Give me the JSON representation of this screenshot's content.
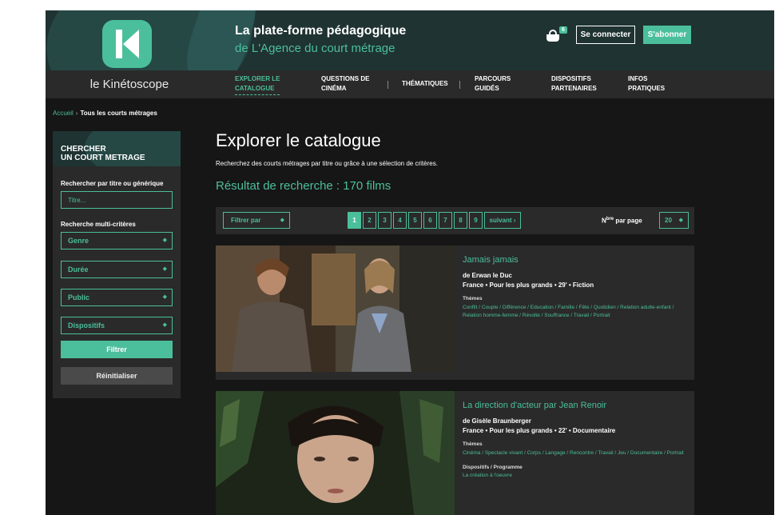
{
  "header": {
    "title_line1": "La plate-forme pédagogique",
    "title_line2": "de L'Agence du court métrage",
    "cart_count": "6",
    "login_label": "Se connecter",
    "subscribe_label": "S'abonner"
  },
  "nav": {
    "brand": "le Kinétoscope",
    "items": [
      {
        "line1": "EXPLORER LE",
        "line2": "CATALOGUE"
      },
      {
        "line1": "QUESTIONS DE",
        "line2": "CINÉMA"
      },
      {
        "line1": "THÉMATIQUES",
        "line2": ""
      },
      {
        "line1": "PARCOURS",
        "line2": "GUIDÉS"
      },
      {
        "line1": "DISPOSITIFS",
        "line2": "PARTENAIRES"
      },
      {
        "line1": "INFOS",
        "line2": "PRATIQUES"
      }
    ]
  },
  "breadcrumb": {
    "home": "Accueil",
    "separator": "›",
    "current": "Tous les courts métrages"
  },
  "sidebar": {
    "title_line1": "CHERCHER",
    "title_line2": "UN COURT METRAGE",
    "search_label": "Rechercher par titre ou générique",
    "search_placeholder": "Titre...",
    "multi_label": "Recherche multi-critères",
    "selects": [
      "Genre",
      "Durée",
      "Public",
      "Dispositifs"
    ],
    "filter_label": "Filtrer",
    "reset_label": "Réinitialiser"
  },
  "main": {
    "title": "Explorer le catalogue",
    "subtitle": "Recherchez des courts métrages par titre ou grâce à une sélection de critères.",
    "results": "Résultat de recherche : 170 films",
    "filter_by": "Filtrer par",
    "pages": [
      "1",
      "2",
      "3",
      "4",
      "5",
      "6",
      "7",
      "8",
      "9"
    ],
    "next_label": "suivant ›",
    "per_page_prefix": "N",
    "per_page_sup": "bre",
    "per_page_suffix": " par page",
    "per_page_value": "20"
  },
  "films": [
    {
      "title": "Jamais jamais",
      "author": "de Erwan le Duc",
      "meta": "France • Pour les plus grands • 29' • Fiction",
      "themes_label": "Thèmes",
      "themes": "Conflit  /  Couple  /  Différence  /  Education  /  Famille  /  Fête  /  Quotidien  /  Relation adulte-enfant  /  Relation homme-femme  /  Révolte  /  Souffrance  /  Travail  /  Portrait"
    },
    {
      "title": "La direction d'acteur par Jean Renoir",
      "author": "de Gisèle Braunberger",
      "meta": "France • Pour les plus grands • 22' • Documentaire",
      "themes_label": "Thèmes",
      "themes": "Cinéma  /  Spectacle vivant  /  Corps  /  Langage  /  Rencontre  /  Travail  /  Jeu  /  Documentaire  /  Portrait",
      "dispositifs_label": "Dispositifs / Programme",
      "dispositifs": "La création à l'oeuvre"
    }
  ],
  "colors": {
    "accent": "#4bbf9b",
    "header_bg": "#1f3332",
    "page_bg": "#161616",
    "panel_bg": "#2a2a2a"
  }
}
